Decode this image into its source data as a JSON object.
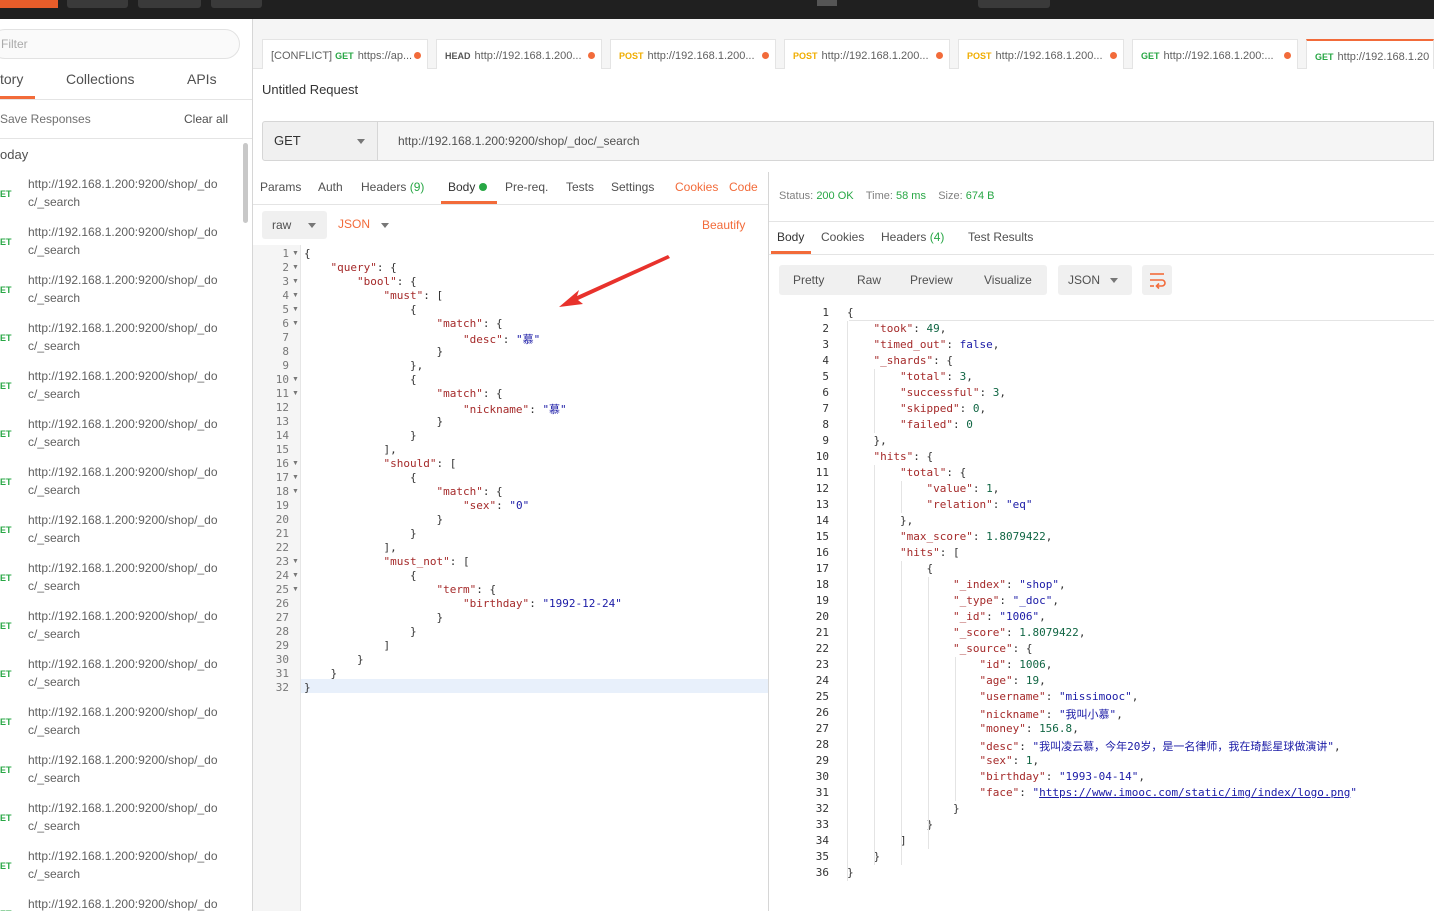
{
  "sidebar": {
    "filter_placeholder": "Filter",
    "tabs": [
      "tory",
      "Collections",
      "APIs"
    ],
    "save_responses": "Save Responses",
    "clear_all": "Clear all",
    "section_label": "oday",
    "history_method": "ET",
    "history_url": "http://192.168.1.200:9200/shop/_doc/_search",
    "history_url_line1": "http://192.168.1.200:9200/shop/_do",
    "history_url_line2": "c/_search"
  },
  "request_tabs": [
    {
      "method": "",
      "label": "[CONFLICT]",
      "method2": "GET",
      "url": "https://ap...",
      "method_color": "#28a745"
    },
    {
      "method": "HEAD",
      "url": "http://192.168.1.200...",
      "method_color": "#555555"
    },
    {
      "method": "POST",
      "url": "http://192.168.1.200...",
      "method_color": "#f0ad00"
    },
    {
      "method": "POST",
      "url": "http://192.168.1.200...",
      "method_color": "#f0ad00"
    },
    {
      "method": "POST",
      "url": "http://192.168.1.200...",
      "method_color": "#f0ad00"
    },
    {
      "method": "GET",
      "url": "http://192.168.1.200:...",
      "method_color": "#28a745"
    },
    {
      "method": "GET",
      "url": "http://192.168.1.20",
      "method_color": "#28a745"
    }
  ],
  "request": {
    "title": "Untitled Request",
    "method": "GET",
    "url": "http://192.168.1.200:9200/shop/_doc/_search",
    "tabs": {
      "params": "Params",
      "auth": "Auth",
      "headers": "Headers",
      "headers_count": "(9)",
      "body": "Body",
      "prereq": "Pre-req.",
      "tests": "Tests",
      "settings": "Settings"
    },
    "cookies": "Cookies",
    "code": "Code",
    "body_mode": "raw",
    "body_format": "JSON",
    "beautify": "Beautify",
    "body_lines": [
      "{",
      "    \"query\": {",
      "        \"bool\": {",
      "            \"must\": [",
      "                {",
      "                    \"match\": {",
      "                        \"desc\": \"慕\"",
      "                    }",
      "                },",
      "                {",
      "                    \"match\": {",
      "                        \"nickname\": \"慕\"",
      "                    }",
      "                }",
      "            ],",
      "            \"should\": [",
      "                {",
      "                    \"match\": {",
      "                        \"sex\": \"0\"",
      "                    }",
      "                }",
      "            ],",
      "            \"must_not\": [",
      "                {",
      "                    \"term\": {",
      "                        \"birthday\": \"1992-12-24\"",
      "                    }",
      "                }",
      "            ]",
      "        }",
      "    }",
      "}"
    ],
    "fold_lines": [
      1,
      2,
      3,
      4,
      5,
      6,
      10,
      11,
      16,
      17,
      18,
      23,
      24,
      25
    ]
  },
  "response": {
    "status_label": "Status:",
    "status_value": "200 OK",
    "time_label": "Time:",
    "time_value": "58 ms",
    "size_label": "Size:",
    "size_value": "674 B",
    "tabs": {
      "body": "Body",
      "cookies": "Cookies",
      "headers": "Headers",
      "headers_count": "(4)",
      "test_results": "Test Results"
    },
    "views": [
      "Pretty",
      "Raw",
      "Preview",
      "Visualize"
    ],
    "format": "JSON",
    "body_lines": [
      "{",
      "    \"took\": 49,",
      "    \"timed_out\": false,",
      "    \"_shards\": {",
      "        \"total\": 3,",
      "        \"successful\": 3,",
      "        \"skipped\": 0,",
      "        \"failed\": 0",
      "    },",
      "    \"hits\": {",
      "        \"total\": {",
      "            \"value\": 1,",
      "            \"relation\": \"eq\"",
      "        },",
      "        \"max_score\": 1.8079422,",
      "        \"hits\": [",
      "            {",
      "                \"_index\": \"shop\",",
      "                \"_type\": \"_doc\",",
      "                \"_id\": \"1006\",",
      "                \"_score\": 1.8079422,",
      "                \"_source\": {",
      "                    \"id\": 1006,",
      "                    \"age\": 19,",
      "                    \"username\": \"missimooc\",",
      "                    \"nickname\": \"我叫小慕\",",
      "                    \"money\": 156.8,",
      "                    \"desc\": \"我叫凌云慕，今年20岁，是一名律师，我在琦髭星球做演讲\",",
      "                    \"sex\": 1,",
      "                    \"birthday\": \"1993-04-14\",",
      "                    \"face\": \"https://www.imooc.com/static/img/index/logo.png\"",
      "                }",
      "            }",
      "        ]",
      "    }",
      "}"
    ]
  },
  "colors": {
    "accent": "#f26b3a",
    "get": "#28a745",
    "post": "#f0ad00",
    "status_ok": "#28a745"
  }
}
